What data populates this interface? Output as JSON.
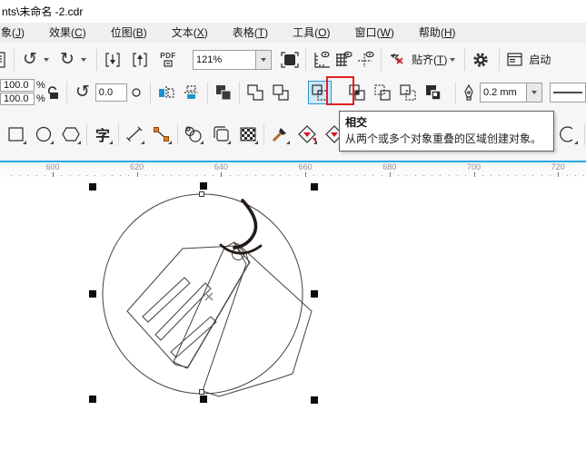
{
  "window": {
    "title_fragment": "nts\\未命名 -2.cdr"
  },
  "menu_bar": {
    "items": [
      {
        "text": "象",
        "key": "J"
      },
      {
        "text": "效果",
        "key": "C"
      },
      {
        "text": "位图",
        "key": "B"
      },
      {
        "text": "文本",
        "key": "X"
      },
      {
        "text": "表格",
        "key": "T"
      },
      {
        "text": "工具",
        "key": "O"
      },
      {
        "text": "窗口",
        "key": "W"
      },
      {
        "text": "帮助",
        "key": "H"
      }
    ]
  },
  "toolbar_standard": {
    "zoom_value": "121%",
    "snap_label_text": "贴齐",
    "snap_label_key": "T",
    "launch_label": "启动",
    "pdf_label": "PDF",
    "icons": [
      "undo-icon",
      "redo-icon",
      "import-icon",
      "export-icon",
      "publish-pdf-icon",
      "fullscreen-preview-icon",
      "show-rulers-icon",
      "show-grid-icon",
      "show-guidelines-icon",
      "snap-off-icon",
      "options-gear-icon",
      "welcome-screen-icon"
    ]
  },
  "property_bar": {
    "scale_x": "100.0",
    "scale_y": "100.0",
    "percent_sign": "%",
    "rotation_angle": "0.0",
    "outline_width": "0.2 mm",
    "shaping_buttons": [
      "combine",
      "weld",
      "trim",
      "intersect",
      "simplify",
      "front-minus-back",
      "back-minus-front",
      "boundary"
    ],
    "highlighted_button": "intersect"
  },
  "toolbox": {
    "text_tool_label": "字",
    "tools": [
      "rectangle",
      "ellipse",
      "polygon",
      "text",
      "freehand-line",
      "bezier",
      "shape",
      "drop-shadow",
      "pattern-fill",
      "color-eyedropper",
      "smart-fill",
      "interactive-fill",
      "contour"
    ]
  },
  "tooltip": {
    "title": "相交",
    "description": "从两个或多个对象重叠的区域创建对象。"
  },
  "ruler": {
    "values": [
      "600",
      "620",
      "640",
      "660",
      "680",
      "700",
      "720"
    ]
  },
  "colors": {
    "highlight_red": "#e31e24",
    "highlight_blue_bg": "#cfe8f8",
    "highlight_blue_border": "#2a96d2",
    "ruler_accent_cyan": "#2aa9e0",
    "tool_orange": "#e87d1e",
    "mirror_blue": "#1d92d1"
  }
}
